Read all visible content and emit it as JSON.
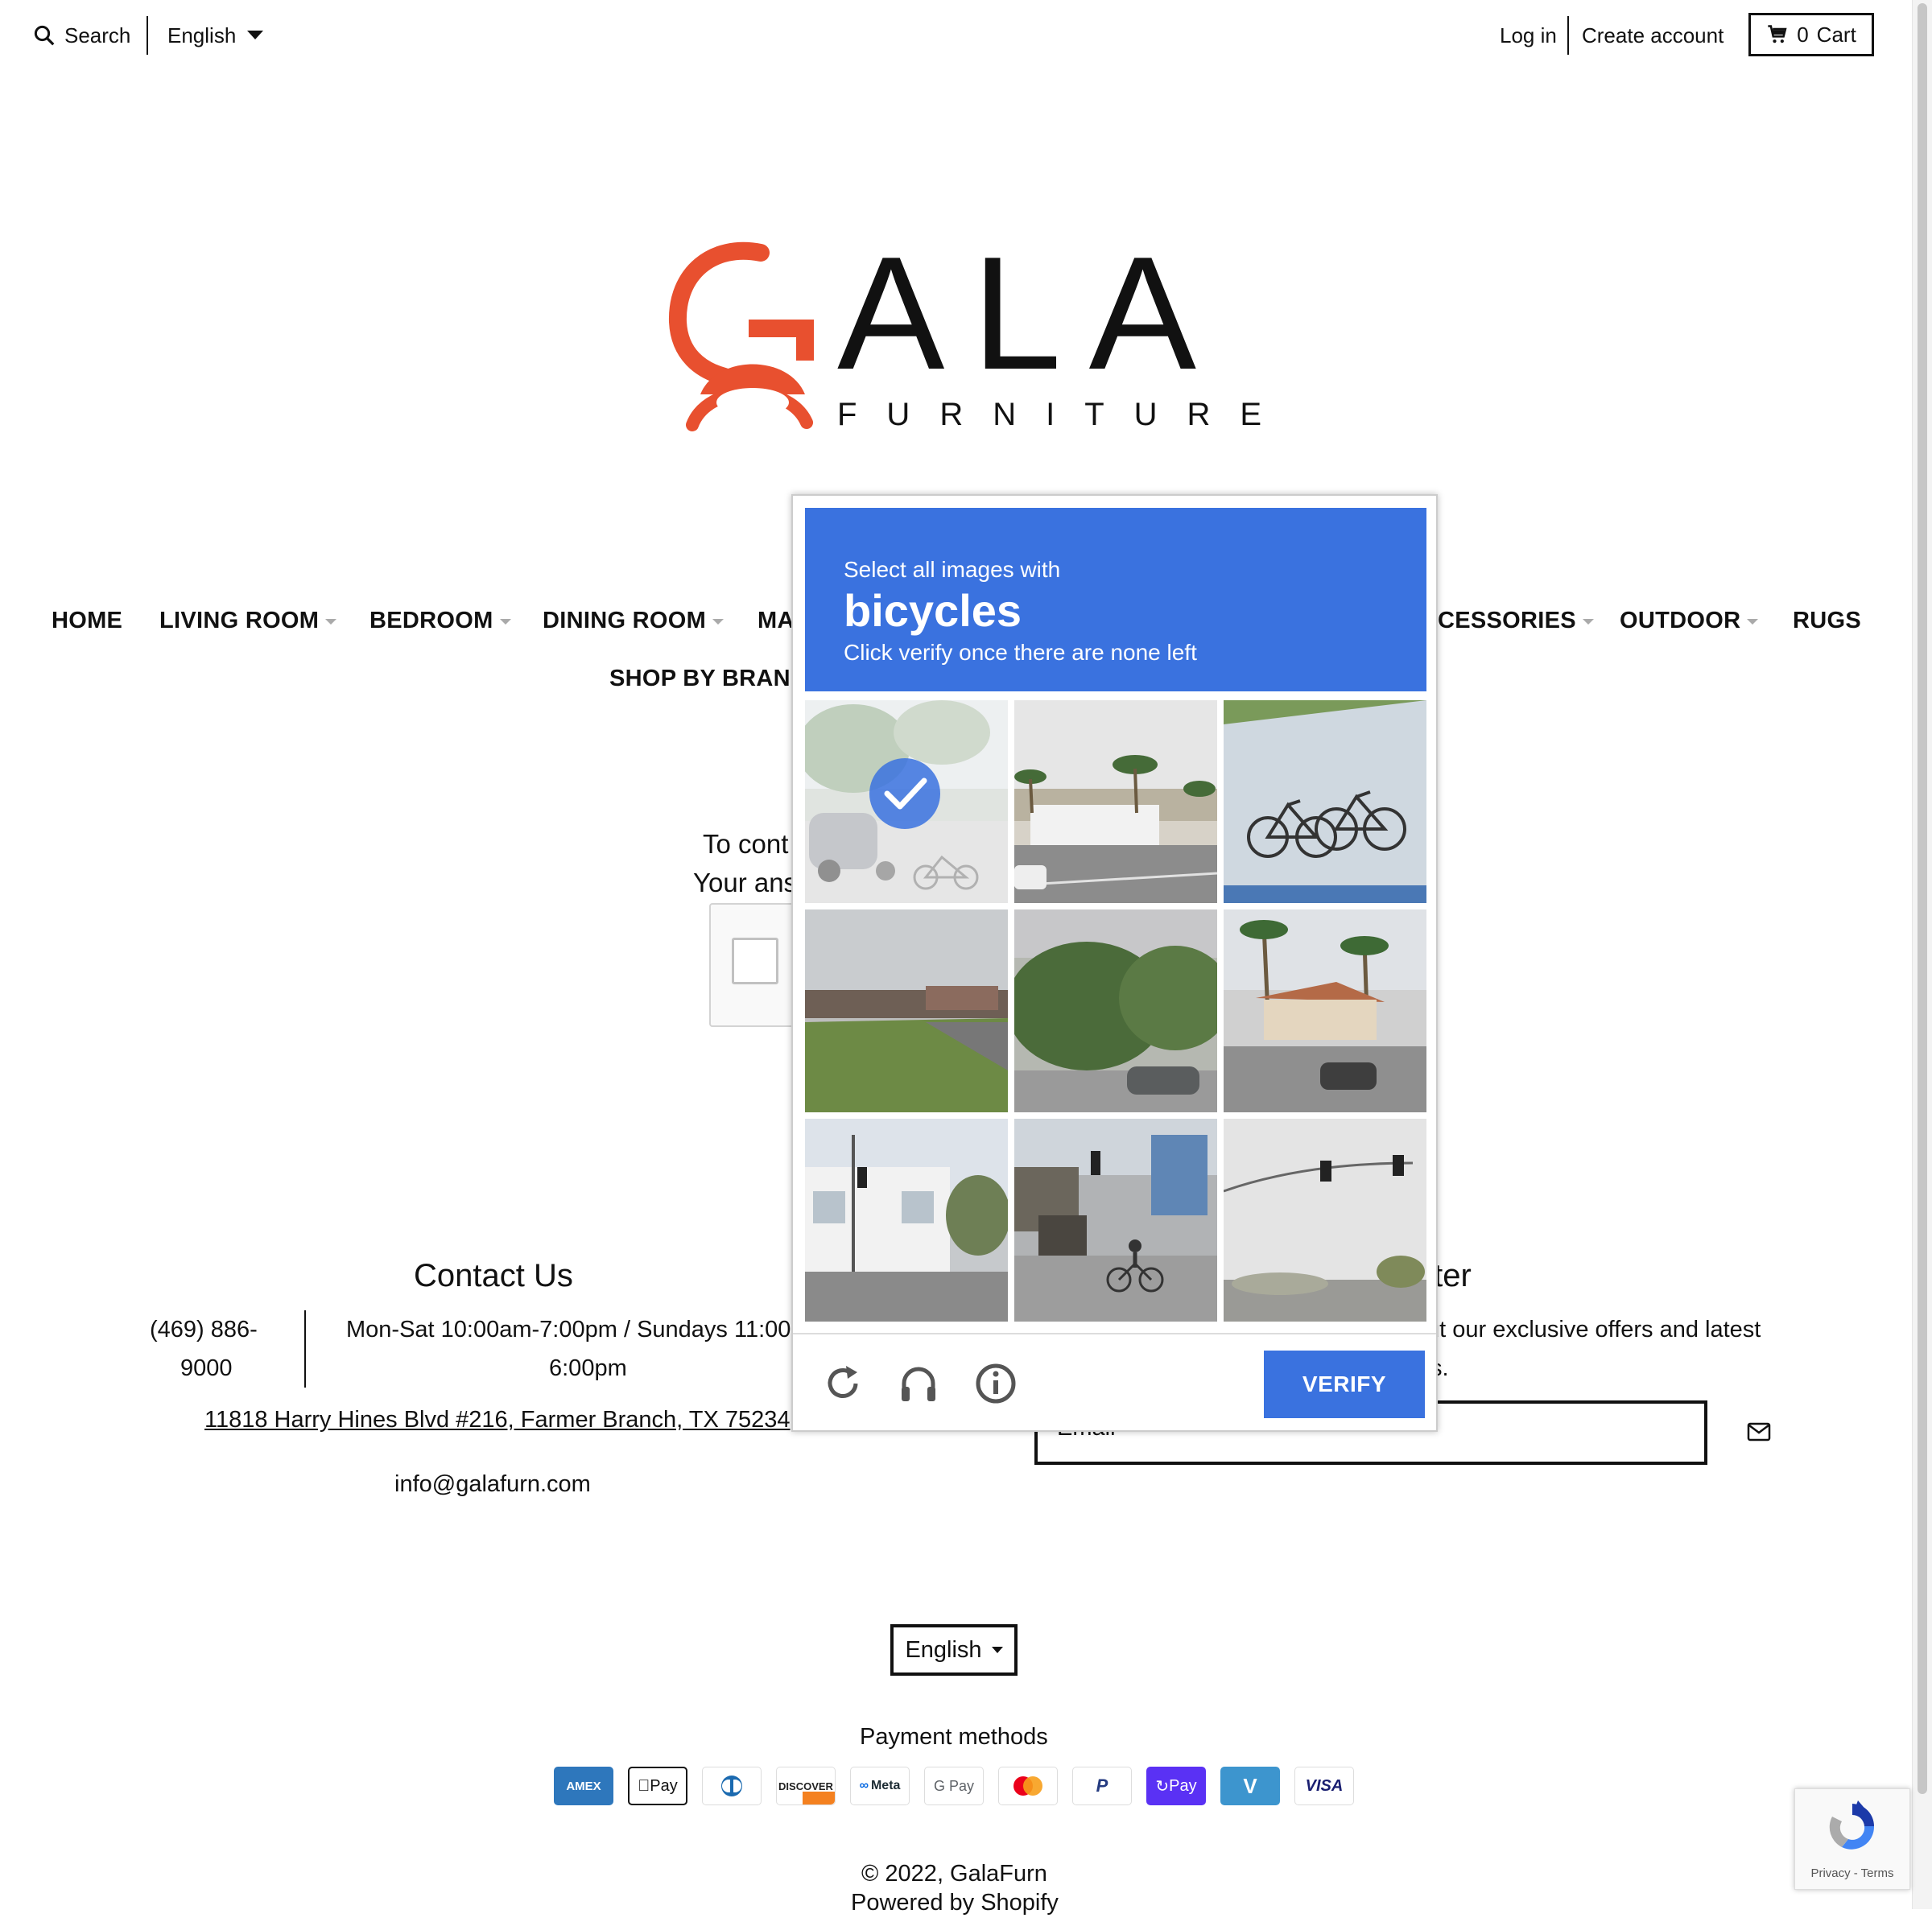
{
  "topbar": {
    "search_label": "Search",
    "language": "English",
    "login": "Log in",
    "create_account": "Create account",
    "cart_count": "0",
    "cart_label": "Cart"
  },
  "logo": {
    "word": "ALA",
    "sub": "FURNITURE",
    "accent_color": "#e8502f"
  },
  "nav": {
    "row1": [
      "HOME",
      "LIVING ROOM",
      "BEDROOM",
      "DINING ROOM",
      "MA",
      "CESSORIES",
      "OUTDOOR",
      "RUGS"
    ],
    "row2": [
      "SHOP BY BRAND"
    ]
  },
  "page": {
    "message_line1": "To cont",
    "message_line2": "Your ans"
  },
  "captcha": {
    "line1": "Select all images with",
    "target": "bicycles",
    "line3": "Click verify once there are none left",
    "verify_label": "VERIFY",
    "icons": [
      "reload-icon",
      "audio-icon",
      "info-icon"
    ],
    "tiles": [
      {
        "name": "tile-street-bike-rack",
        "selected": true
      },
      {
        "name": "tile-palm-road",
        "selected": false
      },
      {
        "name": "tile-truck-bicycles",
        "selected": false
      },
      {
        "name": "tile-field-road",
        "selected": false
      },
      {
        "name": "tile-trees-car",
        "selected": false
      },
      {
        "name": "tile-palm-building",
        "selected": false
      },
      {
        "name": "tile-building-intersection",
        "selected": false
      },
      {
        "name": "tile-cyclist-street",
        "selected": false
      },
      {
        "name": "tile-traffic-light",
        "selected": false
      }
    ],
    "header_color": "#3a72df"
  },
  "footer": {
    "contact_title": "Contact Us",
    "phone_line1": "(469) 886-",
    "phone_line2": "9000",
    "hours_line1": "Mon-Sat 10:00am-7:00pm / Sundays 11:00",
    "hours_line2": "6:00pm",
    "address": "11818 Harry Hines Blvd #216, Farmer Branch, TX 75234",
    "email": "info@galafurn.com",
    "newsletter_title_partial": "tter",
    "newsletter_text1": "ut our exclusive offers and latest",
    "newsletter_text2": "s.",
    "email_placeholder": "Email",
    "language": "English",
    "payment_title": "Payment methods",
    "payment_methods": [
      "AMEX",
      "Pay",
      "",
      "DISCOVER",
      "Meta",
      "G Pay",
      "",
      "P",
      "Pay",
      "V",
      "VISA"
    ],
    "copyright": "© 2022, GalaFurn",
    "powered": "Powered by Shopify"
  },
  "recaptcha_badge": {
    "text": "Privacy - Terms"
  }
}
